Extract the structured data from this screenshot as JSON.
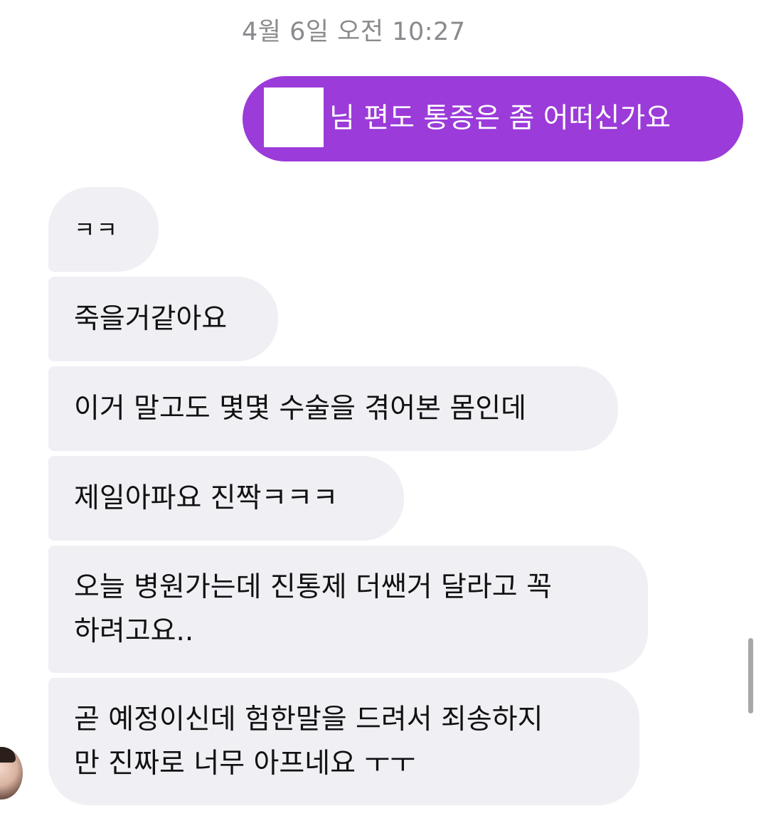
{
  "conversation": {
    "timestamp": "4월 6일 오전 10:27",
    "sent_message": {
      "text": "님 편도 통증은 좀 어떠신가요",
      "redacted_prefix": true
    },
    "received_messages": [
      {
        "lines": [
          "ㅋㅋ"
        ]
      },
      {
        "lines": [
          "죽을거같아요"
        ]
      },
      {
        "lines": [
          "이거 말고도 몇몇 수술을 겪어본 몸인데"
        ]
      },
      {
        "lines": [
          "제일아파요 진짝ㅋㅋㅋ"
        ]
      },
      {
        "lines": [
          "오늘 병원가는데 진통제 더쌘거 달라고 꼭",
          "하려고요.."
        ]
      },
      {
        "lines": [
          "곧 예정이신데 험한말을 드려서 죄송하지",
          "만 진짜로 너무 아프네요 ㅜㅜ"
        ]
      }
    ]
  },
  "colors": {
    "sent_bubble": "#9b3bd9",
    "received_bubble": "#efeff4",
    "timestamp_text": "#8a8a8e",
    "scrollbar": "#a8a8a8"
  },
  "icons": {
    "avatar": "contact-avatar-photo"
  }
}
